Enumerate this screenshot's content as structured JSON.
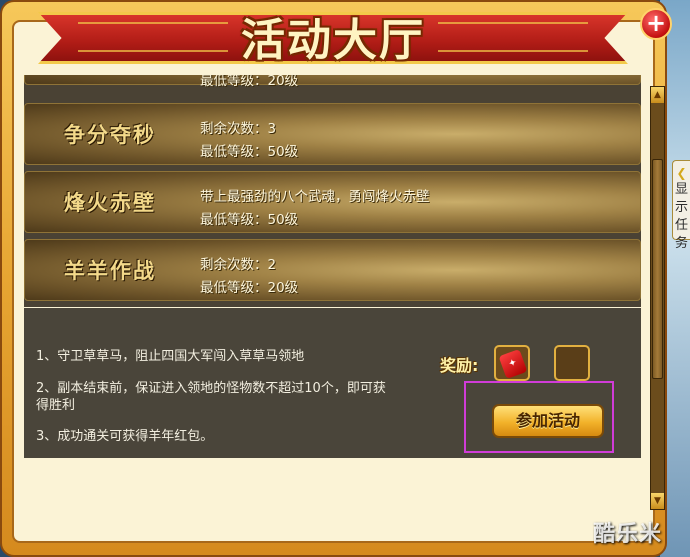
{
  "window": {
    "title": "活动大厅",
    "close_label": "+"
  },
  "side_tab": {
    "chars": [
      "显",
      "示",
      "任",
      "务"
    ]
  },
  "activities": [
    {
      "name": "",
      "line1": "",
      "line2": "最低等级：20级"
    },
    {
      "name": "争分夺秒",
      "line1": "剩余次数：3",
      "line2": "最低等级：50级"
    },
    {
      "name": "烽火赤壁",
      "line1": "带上最强劲的八个武魂，勇闯烽火赤壁",
      "line2": "最低等级：50级"
    },
    {
      "name": "羊羊作战",
      "line1": "剩余次数：2",
      "line2": "最低等级：20级"
    }
  ],
  "details": {
    "lines": [
      "1、守卫草草马，阻止四国大军闯入草草马领地",
      "2、副本结束前，保证进入领地的怪物数不超过10个，即可获得胜利",
      "3、成功通关可获得羊年红包。"
    ],
    "reward_label": "奖励:",
    "join_button": "参加活动"
  },
  "watermark": "酷乐米"
}
